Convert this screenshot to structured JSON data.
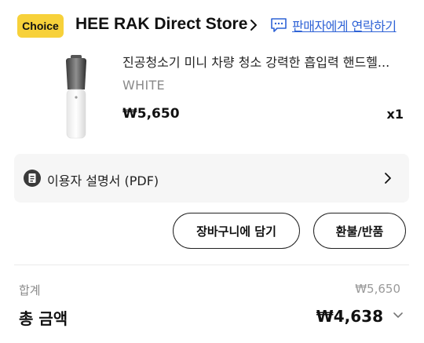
{
  "store": {
    "badge": "Choice",
    "name": "HEE RAK Direct Store",
    "contact_label": "판매자에게 연락하기"
  },
  "product": {
    "title": "진공청소기 미니 차량 청소 강력한 흡입력 핸드헬...",
    "variant": "WHITE",
    "price": "₩5,650",
    "quantity": "x1"
  },
  "manual": {
    "label": "이용자 설명서 (PDF)"
  },
  "actions": {
    "add_to_cart": "장바구니에 담기",
    "refund": "환불/반품"
  },
  "summary": {
    "subtotal_label": "합계",
    "subtotal_value": "₩5,650",
    "total_label": "총 금액",
    "total_value": "₩4,638"
  },
  "icons": {
    "store_chevron": "chevron-right-icon",
    "contact": "chat-bubble-icon",
    "manual": "document-icon",
    "manual_chevron": "chevron-right-icon",
    "total_chevron": "chevron-down-icon"
  },
  "colors": {
    "choice_badge": "#f7d13a",
    "link": "#2f63d6",
    "manual_row_bg": "#f6f6f6"
  }
}
